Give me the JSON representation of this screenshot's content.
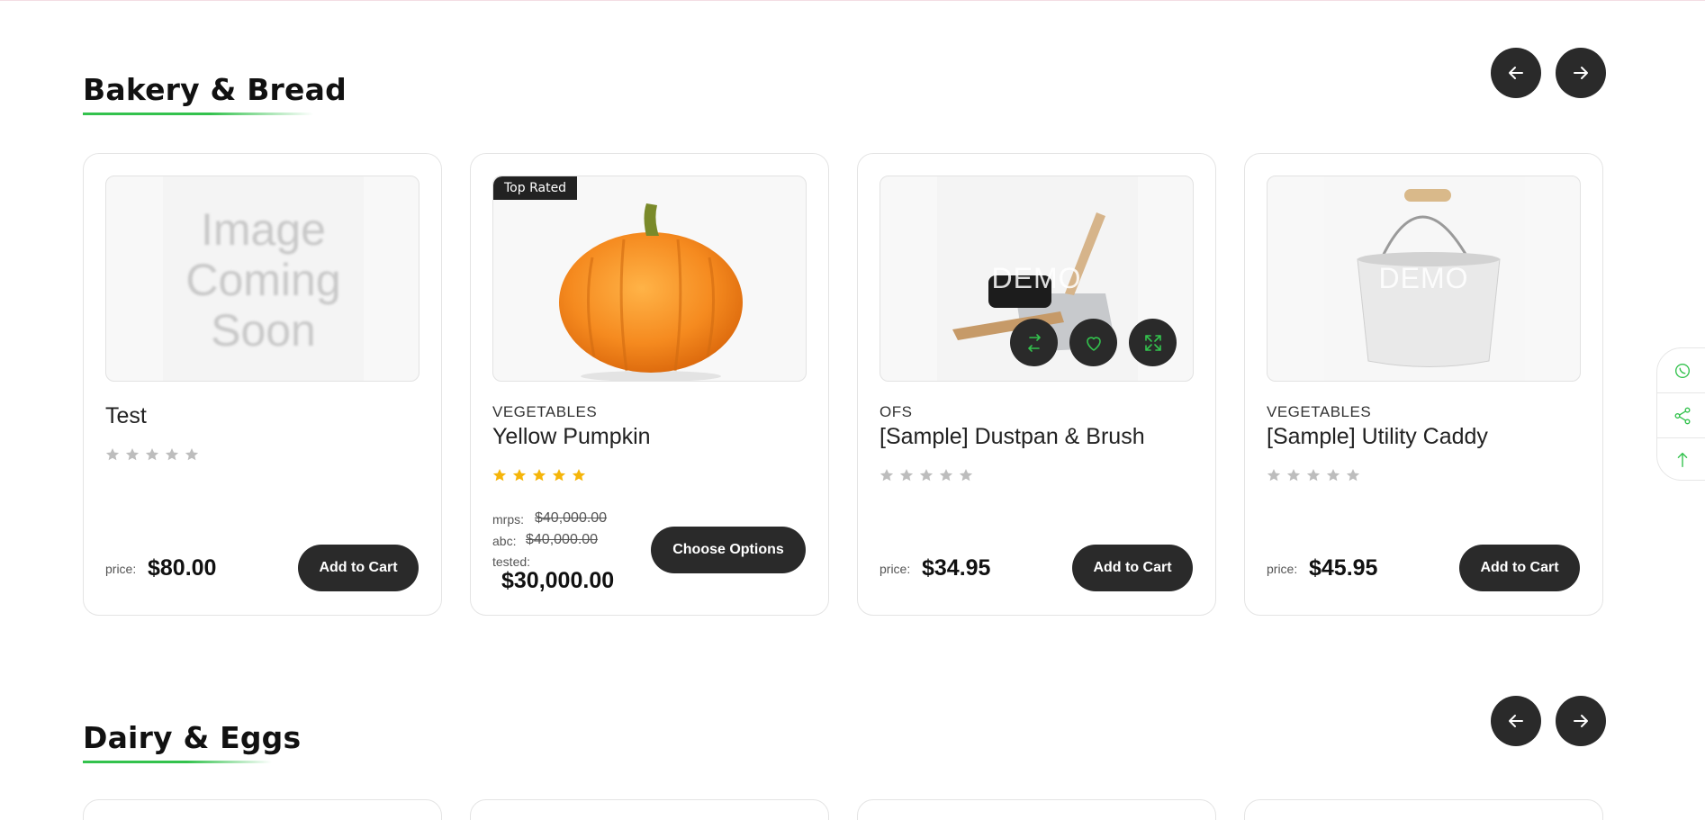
{
  "sections": [
    {
      "title": "Bakery & Bread",
      "products": [
        {
          "name": "Test",
          "category": "",
          "image": "image-coming-soon",
          "image_text_lines": [
            "Image",
            "Coming",
            "Soon"
          ],
          "rating": 0,
          "price_label": "price:",
          "price": "$80.00",
          "button_label": "Add to Cart"
        },
        {
          "name": "Yellow Pumpkin",
          "category": "VEGETABLES",
          "badge": "Top Rated",
          "image": "pumpkin",
          "rating": 5,
          "price_lines": [
            {
              "label": "mrps:",
              "value": "$40,000.00"
            },
            {
              "label": "abc:",
              "value": "$40,000.00"
            }
          ],
          "tested_label": "tested:",
          "price": "$30,000.00",
          "button_label": "Choose Options"
        },
        {
          "name": "[Sample] Dustpan & Brush",
          "category": "OFS",
          "image": "dustpan-and-brush",
          "watermark": "DEMO",
          "rating": 0,
          "price_label": "price:",
          "price": "$34.95",
          "button_label": "Add to Cart",
          "hover_actions": [
            "compare-icon",
            "wishlist-heart-icon",
            "quick-view-expand-icon"
          ]
        },
        {
          "name": "[Sample] Utility Caddy",
          "category": "VEGETABLES",
          "image": "utility-caddy",
          "watermark": "DEMO",
          "rating": 0,
          "price_label": "price:",
          "price": "$45.95",
          "button_label": "Add to Cart"
        }
      ]
    },
    {
      "title": "Dairy & Eggs",
      "products": []
    }
  ],
  "nav": {
    "prev_icon": "arrow-left-icon",
    "next_icon": "arrow-right-icon"
  },
  "side_widget": {
    "items": [
      "whatsapp-icon",
      "share-icon",
      "scroll-to-top-icon"
    ]
  },
  "colors": {
    "accent": "#33c24d",
    "dark": "#2a2a2a",
    "star_filled": "#f5b50a",
    "star_empty": "#bdbdbd"
  }
}
